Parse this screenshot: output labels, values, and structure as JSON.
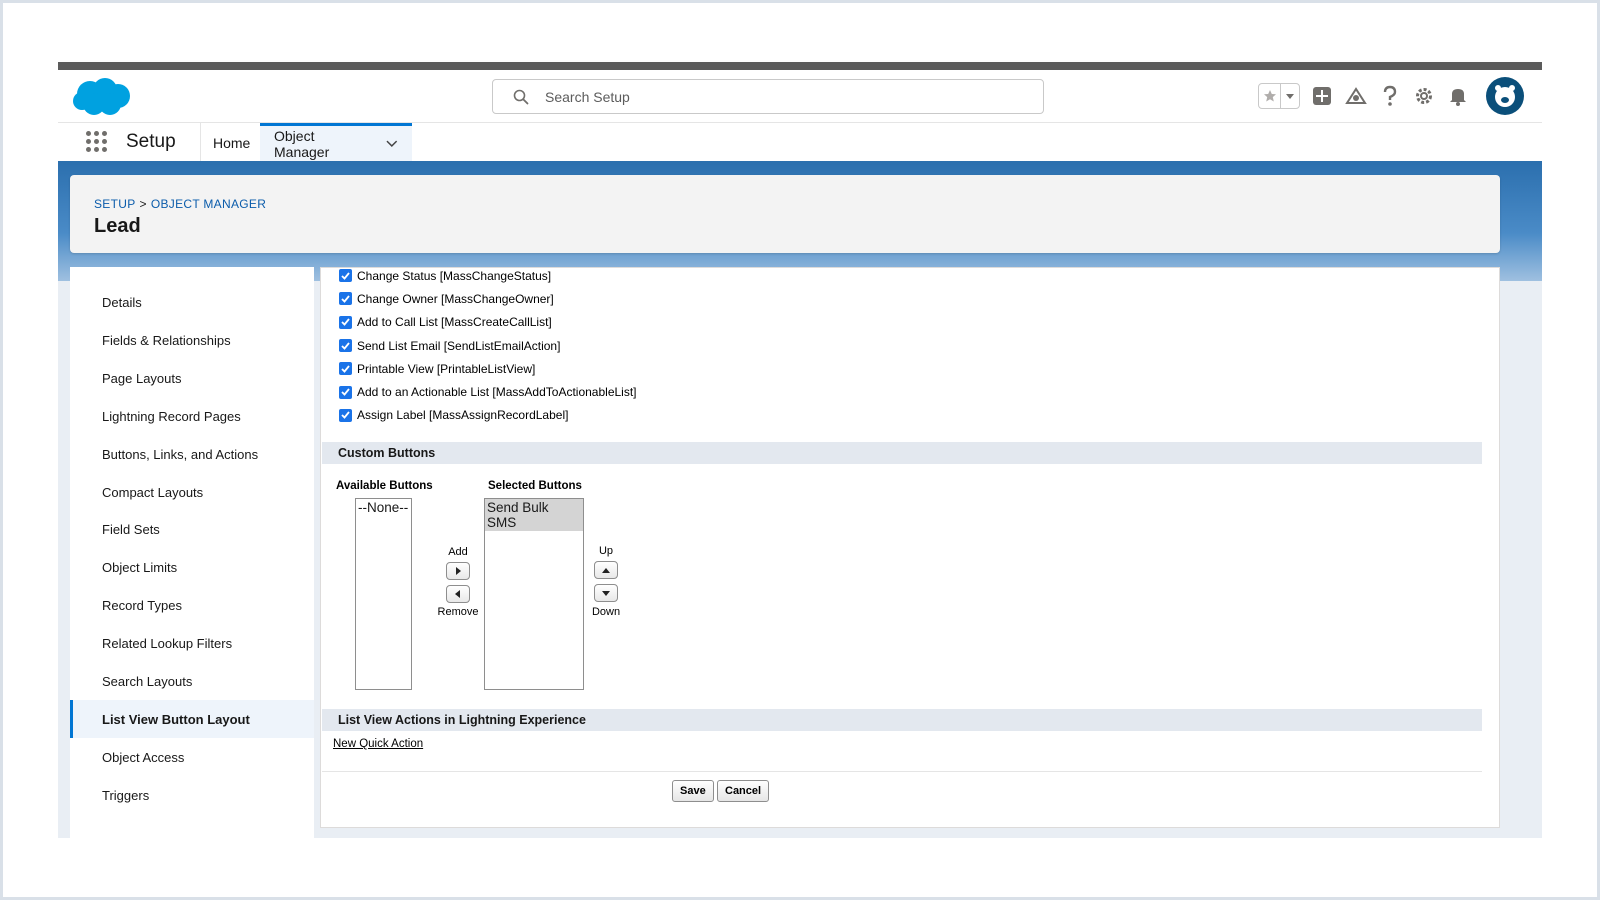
{
  "header": {
    "search_placeholder": "Search Setup"
  },
  "nav": {
    "app_name": "Setup",
    "home": "Home",
    "object_manager": "Object Manager"
  },
  "page": {
    "breadcrumb_setup": "SETUP",
    "breadcrumb_sep": ">",
    "breadcrumb_object_manager": "OBJECT MANAGER",
    "title": "Lead"
  },
  "sidebar": {
    "items": [
      {
        "label": "Details"
      },
      {
        "label": "Fields & Relationships"
      },
      {
        "label": "Page Layouts"
      },
      {
        "label": "Lightning Record Pages"
      },
      {
        "label": "Buttons, Links, and Actions"
      },
      {
        "label": "Compact Layouts"
      },
      {
        "label": "Field Sets"
      },
      {
        "label": "Object Limits"
      },
      {
        "label": "Record Types"
      },
      {
        "label": "Related Lookup Filters"
      },
      {
        "label": "Search Layouts"
      },
      {
        "label": "List View Button Layout"
      },
      {
        "label": "Object Access"
      },
      {
        "label": "Triggers"
      }
    ],
    "active": "List View Button Layout"
  },
  "standard_buttons": [
    {
      "label": "Change Status [MassChangeStatus]",
      "checked": true
    },
    {
      "label": "Change Owner [MassChangeOwner]",
      "checked": true
    },
    {
      "label": "Add to Call List [MassCreateCallList]",
      "checked": true
    },
    {
      "label": "Send List Email [SendListEmailAction]",
      "checked": true
    },
    {
      "label": "Printable View [PrintableListView]",
      "checked": true
    },
    {
      "label": "Add to an Actionable List [MassAddToActionableList]",
      "checked": true
    },
    {
      "label": "Assign Label [MassAssignRecordLabel]",
      "checked": true
    }
  ],
  "custom_buttons": {
    "section_title": "Custom Buttons",
    "available_label": "Available Buttons",
    "selected_label": "Selected Buttons",
    "available_options": [
      "--None--"
    ],
    "selected_options": [
      "Send Bulk SMS"
    ],
    "add_label": "Add",
    "remove_label": "Remove",
    "up_label": "Up",
    "down_label": "Down"
  },
  "lightning_actions": {
    "section_title": "List View Actions in Lightning Experience",
    "new_quick_action": "New Quick Action"
  },
  "footer": {
    "save": "Save",
    "cancel": "Cancel"
  },
  "colors": {
    "brand_blue": "#0176d3",
    "checkbox_blue": "#1a73e8",
    "logo_blue": "#00a1e0"
  }
}
